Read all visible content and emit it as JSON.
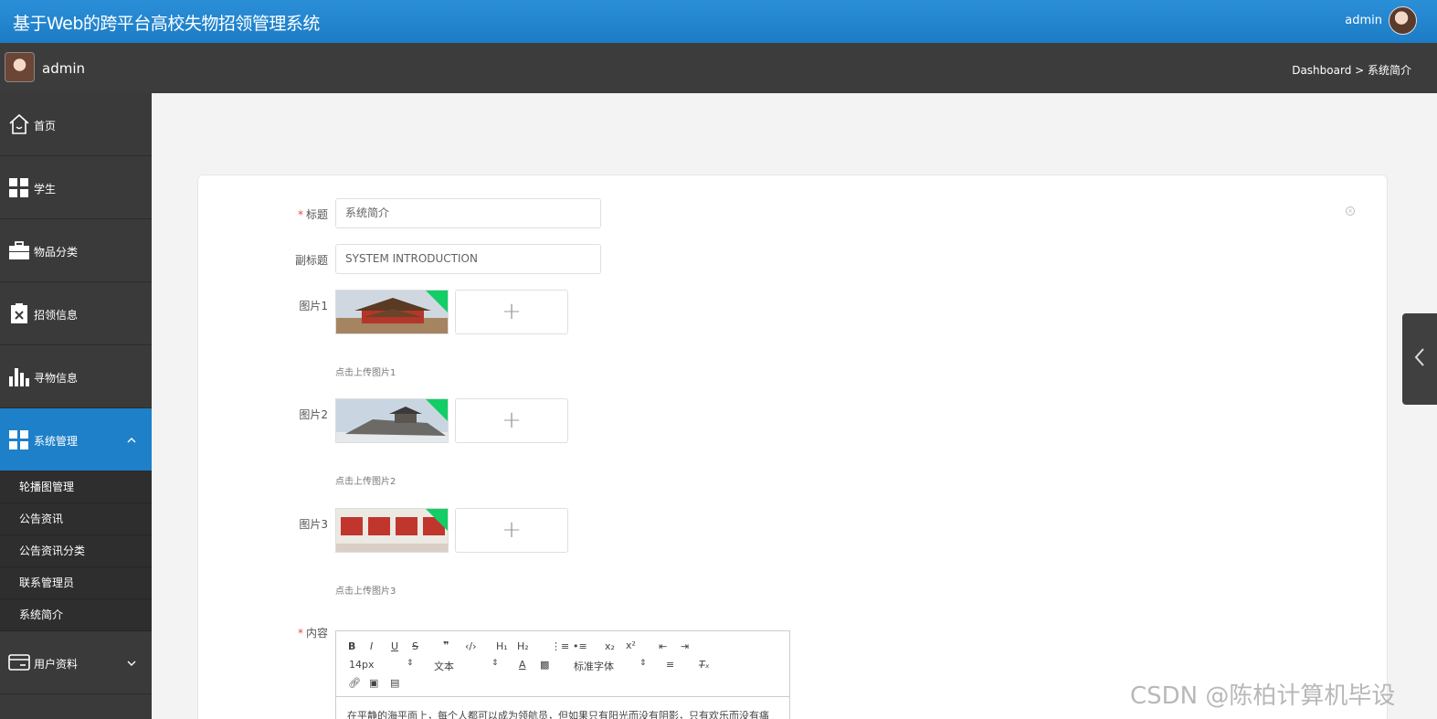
{
  "header": {
    "app_title": "基于Web的跨平台高校失物招领管理系统",
    "user_name": "admin"
  },
  "subheader": {
    "user_name": "admin",
    "breadcrumb": "Dashboard > 系统简介"
  },
  "sidebar": {
    "items": [
      {
        "label": "首页",
        "icon": "home-icon"
      },
      {
        "label": "学生",
        "icon": "grid-icon"
      },
      {
        "label": "物品分类",
        "icon": "briefcase-icon"
      },
      {
        "label": "招领信息",
        "icon": "clipboard-icon"
      },
      {
        "label": "寻物信息",
        "icon": "bar-chart-icon"
      },
      {
        "label": "系统管理",
        "icon": "grid-icon",
        "expanded": true
      }
    ],
    "sub_items": [
      "轮播图管理",
      "公告资讯",
      "公告资讯分类",
      "联系管理员",
      "系统简介"
    ],
    "last_item": {
      "label": "用户资料",
      "icon": "card-icon"
    }
  },
  "form": {
    "title_label": "标题",
    "title_value": "系统简介",
    "subtitle_label": "副标题",
    "subtitle_value": "SYSTEM INTRODUCTION",
    "images": [
      {
        "label": "图片1",
        "hint": "点击上传图片1"
      },
      {
        "label": "图片2",
        "hint": "点击上传图片2"
      },
      {
        "label": "图片3",
        "hint": "点击上传图片3"
      }
    ],
    "upload_plus": "+",
    "content_label": "内容"
  },
  "editor": {
    "font_size": "14px",
    "paragraph": "文本",
    "font_family": "标准字体",
    "body_text": "在平静的海平面上，每个人都可以成为领航员，但如果只有阳光而没有阴影，只有欢乐而没有痛"
  },
  "watermark": "CSDN @陈柏计算机毕设"
}
